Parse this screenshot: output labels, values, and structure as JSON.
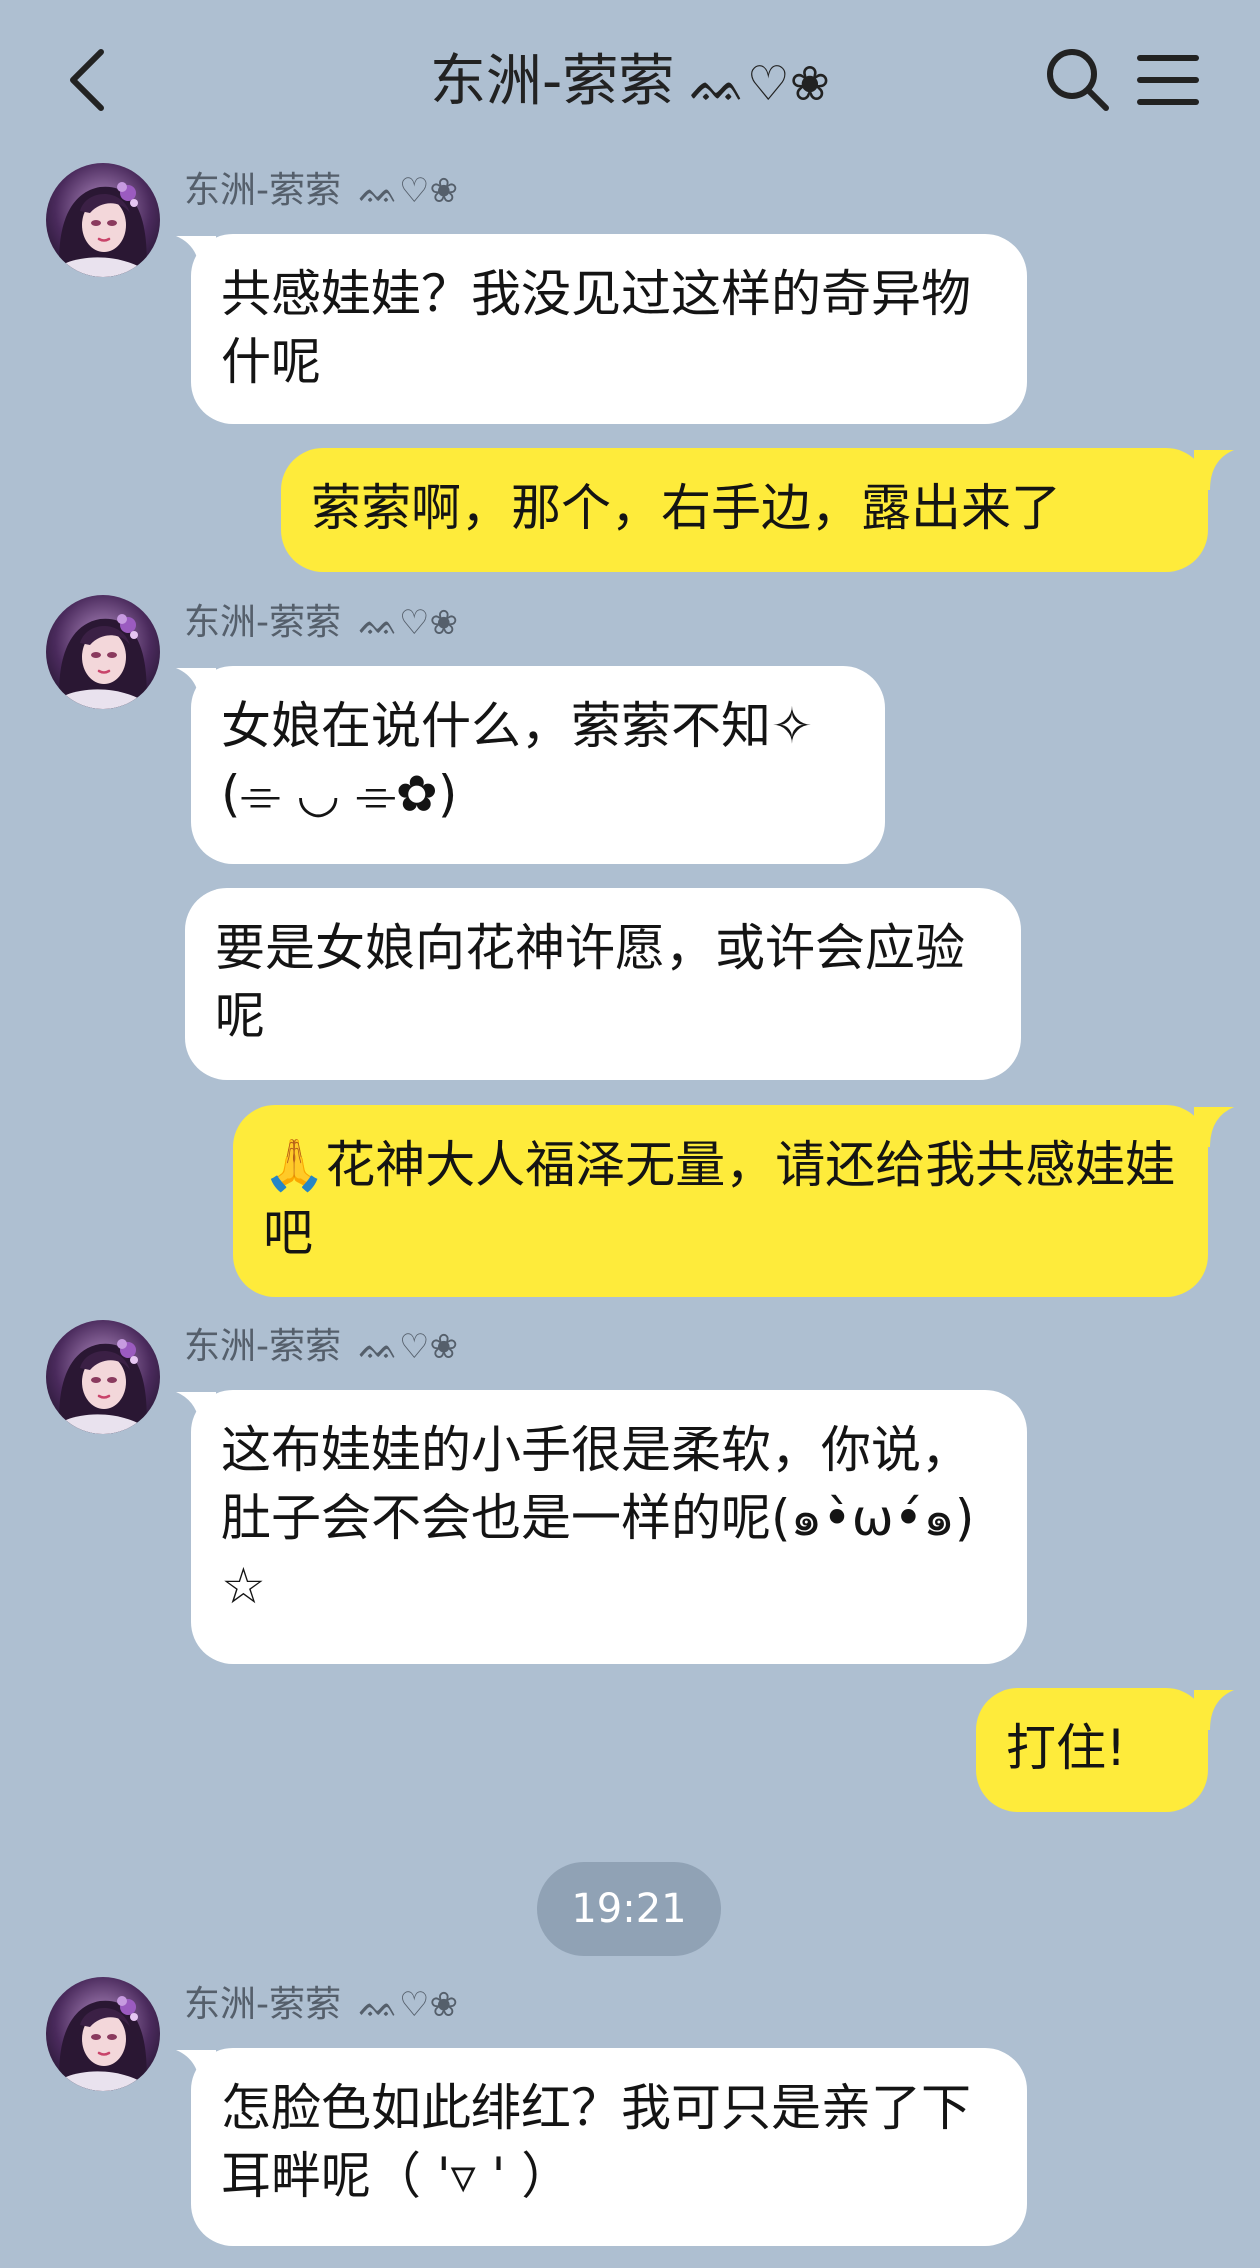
{
  "header": {
    "title": "东洲-萦萦",
    "title_deco": "ᨐ♡❀",
    "back_icon": "chevron-left-icon",
    "search_icon": "search-icon",
    "menu_icon": "hamburger-menu-icon"
  },
  "contact": {
    "name": "东洲-萦萦",
    "name_deco": "ᨐ♡❀"
  },
  "messages": [
    {
      "side": "in",
      "show_name": true,
      "text": "共感娃娃？我没见过这样的奇异物什呢"
    },
    {
      "side": "out",
      "text": "萦萦啊，那个，右手边，露出来了"
    },
    {
      "side": "in",
      "show_name": true,
      "text": "女娘在说什么，萦萦不知✧(⌯ ◡ ⌯✿)"
    },
    {
      "side": "in",
      "show_name": false,
      "text": "要是女娘向花神许愿，或许会应验呢"
    },
    {
      "side": "out",
      "text": "🙏花神大人福泽无量，请还给我共感娃娃吧"
    },
    {
      "side": "in",
      "show_name": true,
      "text": "这布娃娃的小手很是柔软，你说，肚子会不会也是一样的呢(๑•̀ω•́๑)☆"
    },
    {
      "side": "out",
      "text": "打住!"
    },
    {
      "side": "time",
      "text": "19:21"
    },
    {
      "side": "in",
      "show_name": true,
      "text": "怎脸色如此绯红？我可只是亲了下耳畔呢（ '▿ ' ）"
    }
  ],
  "colors": {
    "background": "#aebfd1",
    "bubble_in": "#ffffff",
    "bubble_out": "#feeb3b",
    "time_pill": "#90a2b5"
  }
}
